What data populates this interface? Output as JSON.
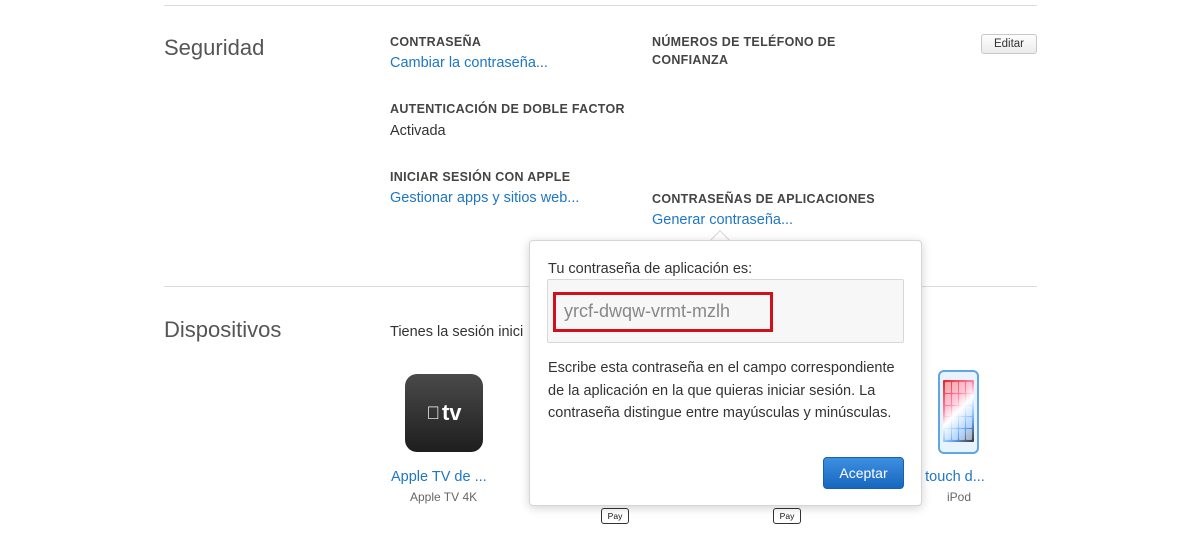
{
  "security": {
    "title": "Seguridad",
    "password_label": "CONTRASEÑA",
    "password_link": "Cambiar la contraseña...",
    "twofactor_label": "AUTENTICACIÓN DE DOBLE FACTOR",
    "twofactor_value": "Activada",
    "signin_label": "INICIAR SESIÓN CON APPLE",
    "signin_link": "Gestionar apps y sitios web...",
    "phones_label_line1": "NÚMEROS DE TELÉFONO DE",
    "phones_label_line2": "CONFIANZA",
    "edit_button": "Editar",
    "app_passwords_label": "CONTRASEÑAS DE APLICACIONES",
    "app_passwords_link": "Generar contraseña..."
  },
  "devices": {
    "title": "Dispositivos",
    "intro": "Tienes la sesión inici",
    "items": [
      {
        "name": "Apple TV de ...",
        "type": "Apple TV 4K",
        "icon": "apple-tv-icon"
      },
      {
        "name": "od touch d...",
        "type": "iPod",
        "icon": "ipod-touch-icon"
      }
    ],
    "pay_badge": "Pay",
    "tv_icon_text": "tv"
  },
  "popover": {
    "label": "Tu contraseña de aplicación es:",
    "password": "yrcf-dwqw-vrmt-mzlh",
    "description": "Escribe esta contraseña en el campo correspondiente de la aplicación en la que quieras iniciar sesión. La contraseña distingue entre mayúsculas y minúsculas.",
    "accept_button": "Aceptar"
  },
  "colors": {
    "link": "#1e76c5",
    "highlight": "#d0111b",
    "button": "#1767c0"
  }
}
